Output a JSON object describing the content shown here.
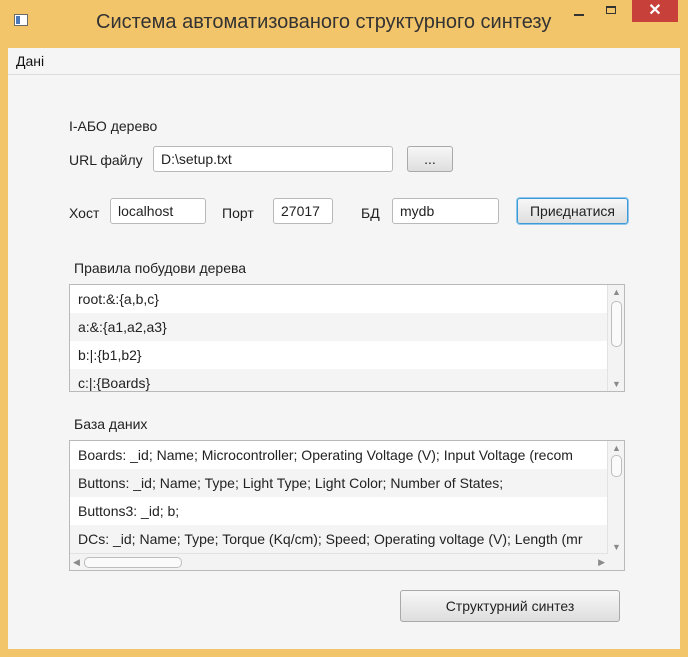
{
  "window": {
    "title": "Система автоматизованого структурного синтезу",
    "close_glyph": "✕",
    "accent_color": "#f3c56b",
    "close_color": "#c7403a"
  },
  "menu": {
    "items": [
      "Дані"
    ]
  },
  "tree_section": {
    "heading": "І-АБО дерево",
    "url_label": "URL файлу",
    "url_value": "D:\\setup.txt",
    "browse_label": "..."
  },
  "connection": {
    "host_label": "Хост",
    "host_value": "localhost",
    "port_label": "Порт",
    "port_value": "27017",
    "db_label": "БД",
    "db_value": "mydb",
    "connect_label": "Приєднатися"
  },
  "rules": {
    "heading": "Правила побудови дерева",
    "items": [
      "root:&:{a,b,c}",
      "a:&:{a1,a2,a3}",
      "b:|:{b1,b2}",
      "c:|:{Boards}"
    ]
  },
  "database": {
    "heading": "База даних",
    "items": [
      "Boards: _id; Name; Microcontroller; Operating Voltage (V); Input Voltage (recom",
      "Buttons: _id; Name; Type; Light Type; Light Color; Number of States;",
      "Buttons3: _id; b;",
      "DCs: _id; Name; Type; Torque (Kq/cm); Speed; Operating voltage (V); Length (mr"
    ]
  },
  "actions": {
    "synthesis_label": "Структурний синтез"
  },
  "icons": {
    "app": "app-icon",
    "minimize": "minimize-icon",
    "maximize": "maximize-icon",
    "close": "close-icon"
  }
}
